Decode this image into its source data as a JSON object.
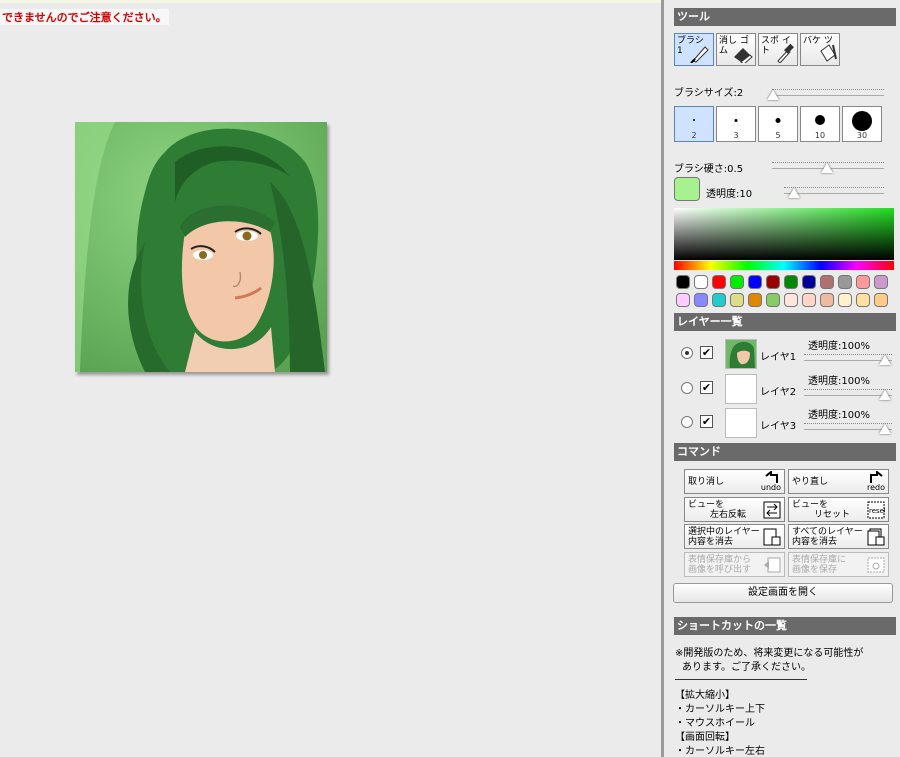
{
  "notice": "できませんのでご注意ください。",
  "tools": {
    "header": "ツール",
    "items": [
      {
        "label": "ブラシ 1",
        "icon": "brush-icon"
      },
      {
        "label": "消し ゴム",
        "icon": "eraser-icon"
      },
      {
        "label": "スポ イト",
        "icon": "eyedropper-icon"
      },
      {
        "label": "バケ ツ",
        "icon": "bucket-icon"
      }
    ],
    "brush_size_label": "ブラシサイズ:2",
    "brush_size": 2,
    "size_presets": [
      "2",
      "3",
      "5",
      "10",
      "30"
    ],
    "hardness_label": "ブラシ硬さ:0.5",
    "hardness": 0.5,
    "opacity_label": "透明度:10",
    "opacity": 10,
    "current_color": "#a6f28f",
    "palette_row1": [
      "#000000",
      "#ffffff",
      "#ff0000",
      "#00ee00",
      "#0000ff",
      "#990000",
      "#008800",
      "#000099",
      "#b07070",
      "#999999",
      "#ff9999",
      "#cc99cc"
    ],
    "palette_row2": [
      "#ffccff",
      "#8888ff",
      "#22cccc",
      "#dddd88",
      "#dd8800",
      "#88cc66",
      "#ffe6dd",
      "#ffd6c6",
      "#eebba0",
      "#fff0d0",
      "#ffe0a0",
      "#ffcc88"
    ]
  },
  "layers": {
    "header": "レイヤー一覧",
    "items": [
      {
        "name": "レイヤ1",
        "opacity": "透明度:100%",
        "selected": true,
        "visible": "✔"
      },
      {
        "name": "レイヤ2",
        "opacity": "透明度:100%",
        "selected": false,
        "visible": "✔"
      },
      {
        "name": "レイヤ3",
        "opacity": "透明度:100%",
        "selected": false,
        "visible": "✔"
      }
    ]
  },
  "commands": {
    "header": "コマンド",
    "undo": {
      "label": "取り消し",
      "tag": "undo"
    },
    "redo": {
      "label": "やり直し",
      "tag": "redo"
    },
    "flip": {
      "line1": "ビューを",
      "line2": "左右反転"
    },
    "reset": {
      "line1": "ビューを",
      "line2": "リセット",
      "tag": "reset"
    },
    "clear_layer": {
      "line1": "選択中のレイヤー",
      "line2": "内容を消去"
    },
    "clear_all": {
      "line1": "すべてのレイヤー",
      "line2": "内容を消去"
    },
    "load": {
      "line1": "表情保存庫から",
      "line2": "画像を呼び出す"
    },
    "save": {
      "line1": "表情保存庫に",
      "line2": "画像を保存"
    },
    "settings": "設定画面を開く"
  },
  "shortcuts": {
    "header": "ショートカットの一覧",
    "note1": "※開発版のため、将来変更になる可能性が",
    "note2": "あります。ご了承ください。",
    "lines": [
      "【拡大縮小】",
      "・カーソルキー上下",
      "・マウスホイール",
      "【画面回転】",
      "・カーソルキー左右"
    ]
  }
}
